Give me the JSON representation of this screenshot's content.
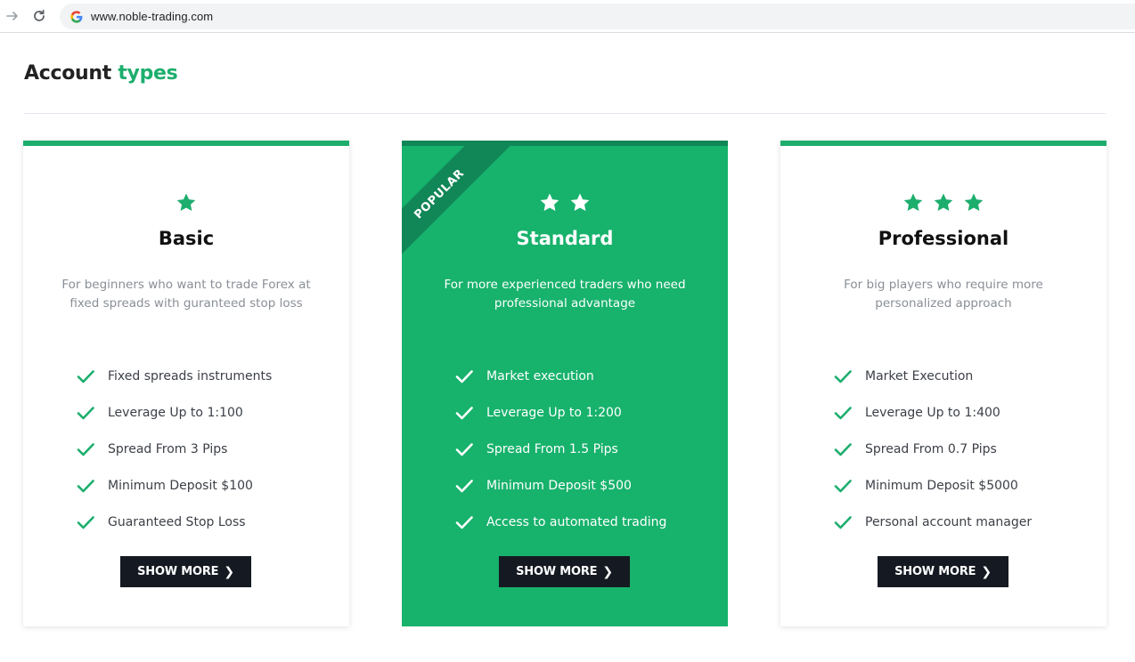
{
  "browser": {
    "url": "www.noble-trading.com"
  },
  "heading": {
    "title_plain": "Account ",
    "title_accent": "types"
  },
  "colors": {
    "brand_green": "#1dae6d",
    "featured_bg": "#17b26c",
    "ribbon_bg": "#118657",
    "button_bg": "#151a22"
  },
  "cards": [
    {
      "name": "Basic",
      "stars": 1,
      "description": "For beginners who want to trade Forex at fixed spreads with guranteed stop loss",
      "features": [
        "Fixed spreads instruments",
        "Leverage Up to 1:100",
        "Spread From 3 Pips",
        "Minimum Deposit $100",
        "Guaranteed Stop Loss"
      ],
      "button_label": "SHOW MORE",
      "button_icon": "chevron-right-icon"
    },
    {
      "name": "Standard",
      "stars": 2,
      "badge": "POPULAR",
      "description": "For more experienced traders who need professional advantage",
      "features": [
        "Market execution",
        "Leverage Up to 1:200",
        "Spread From 1.5 Pips",
        "Minimum Deposit $500",
        "Access to automated trading"
      ],
      "button_label": "SHOW MORE",
      "button_icon": "chevron-right-icon"
    },
    {
      "name": "Professional",
      "stars": 3,
      "description": "For big players who require more personalized approach",
      "features": [
        "Market Execution",
        "Leverage Up to 1:400",
        "Spread From 0.7 Pips",
        "Minimum Deposit $5000",
        "Personal account manager"
      ],
      "button_label": "SHOW MORE",
      "button_icon": "chevron-right-icon"
    }
  ]
}
